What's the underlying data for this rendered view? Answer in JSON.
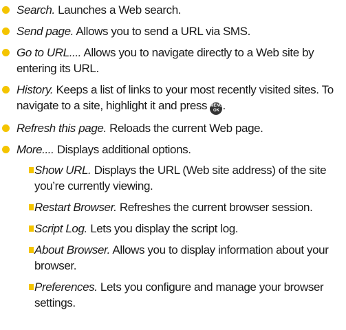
{
  "items": [
    {
      "term": "Search.",
      "desc": " Launches a Web search."
    },
    {
      "term": "Send page.",
      "desc": " Allows you to send a URL via SMS."
    },
    {
      "term": "Go to URL....",
      "desc": " Allows you to navigate directly to a Web site by entering its URL."
    },
    {
      "term": "History.",
      "desc": " Keeps a list of links to your most recently visited sites. To navigate to a site, highlight it and press",
      "icon_top": "MENU",
      "icon_bottom": "OK",
      "desc_end": "."
    },
    {
      "term": "Refresh this page.",
      "desc": " Reloads the current Web page."
    },
    {
      "term": "More....",
      "desc": " Displays additional options."
    }
  ],
  "sub_items": [
    {
      "term": "Show URL.",
      "desc": " Displays the URL (Web site address) of the site you’re currently viewing."
    },
    {
      "term": "Restart Browser.",
      "desc": " Refreshes the current browser session."
    },
    {
      "term": "Script Log.",
      "desc": " Lets you display the script log."
    },
    {
      "term": "About Browser.",
      "desc": " Allows you to display information about your browser."
    },
    {
      "term": "Preferences.",
      "desc": " Lets you configure and manage your browser settings."
    }
  ],
  "colors": {
    "bullet": "#f4c400",
    "text": "#1a1a1a"
  },
  "icons": {
    "menu_ok": "menu-ok-key-icon"
  }
}
